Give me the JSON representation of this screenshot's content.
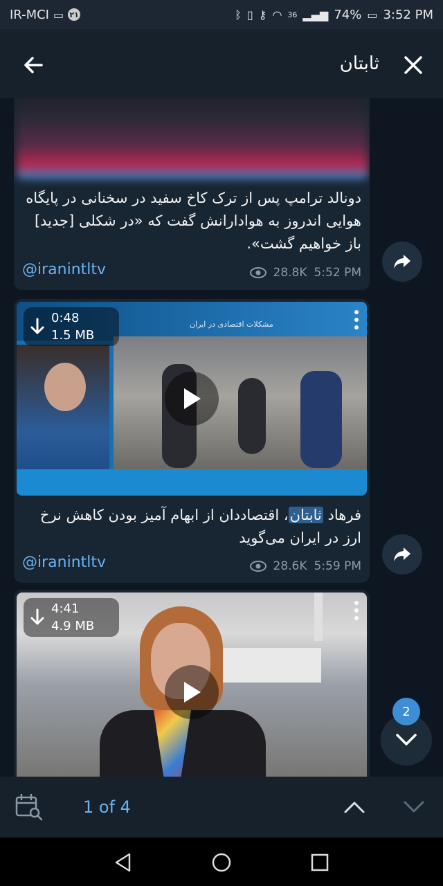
{
  "status_bar": {
    "carrier": "IR-MCI",
    "sim_badge": "۲۱",
    "network": "36",
    "battery": "74%",
    "time": "3:52 PM"
  },
  "search": {
    "query": "ثابتان"
  },
  "messages": [
    {
      "caption": "دونالد ترامپ پس از ترک کاخ سفید در سخنانی در پایگاه هوایی اندروز به هوادارانش گفت که «در شکلی [جدید] باز خواهیم گشت».",
      "channel": "@iranintltv",
      "views": "28.8K",
      "time": "5:52 PM"
    },
    {
      "duration": "0:48",
      "size": "1.5 MB",
      "caption_before": "فرهاد ",
      "caption_highlight": "ثابتان",
      "caption_after": "، اقتصاددان از ابهام آمیز بودن کاهش نرخ ارز در ایران می‌گوید",
      "channel": "@iranintltv",
      "views": "28.6K",
      "time": "5:59 PM",
      "video_header_text": "مشکلات اقتصادی در ایران"
    },
    {
      "duration": "4:41",
      "size": "4.9 MB"
    }
  ],
  "unread_count": "2",
  "bottom_bar": {
    "results_counter": "1 of 4"
  },
  "icons": {
    "accent": "#6ab3f3",
    "bubble": "#182533",
    "background": "#0e1621"
  }
}
